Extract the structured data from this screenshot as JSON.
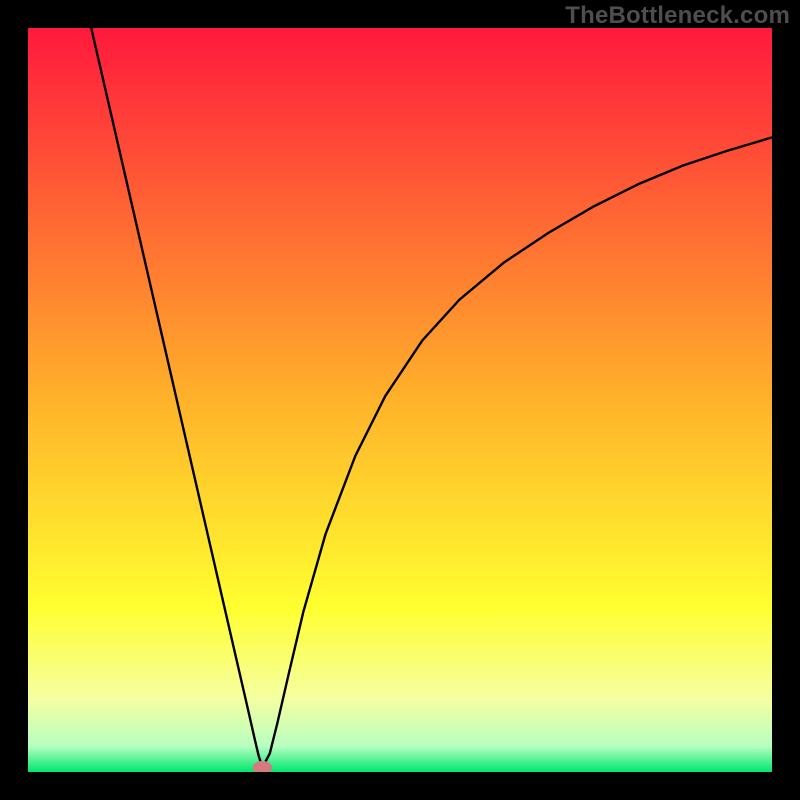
{
  "watermark": "TheBottleneck.com",
  "chart_data": {
    "type": "line",
    "title": "",
    "xlabel": "",
    "ylabel": "",
    "xlim": [
      0,
      100
    ],
    "ylim": [
      0,
      100
    ],
    "grid": false,
    "legend": false,
    "background_gradient_stops": [
      {
        "offset": 0.0,
        "color": "#ff193d"
      },
      {
        "offset": 0.5,
        "color": "#ffb22a"
      },
      {
        "offset": 0.78,
        "color": "#ffff30"
      },
      {
        "offset": 0.9,
        "color": "#f6ffa0"
      },
      {
        "offset": 0.965,
        "color": "#b8ffc0"
      },
      {
        "offset": 1.0,
        "color": "#00e66e"
      }
    ],
    "minimum_marker": {
      "x": 31.5,
      "y": 0.6,
      "rx": 1.3,
      "ry": 0.9,
      "color": "#d67a82"
    },
    "series": [
      {
        "name": "curve",
        "color": "#000000",
        "points": [
          {
            "x": 8.5,
            "y": 100.0
          },
          {
            "x": 10.0,
            "y": 93.5
          },
          {
            "x": 12.0,
            "y": 84.8
          },
          {
            "x": 14.0,
            "y": 76.1
          },
          {
            "x": 16.0,
            "y": 67.4
          },
          {
            "x": 18.0,
            "y": 58.7
          },
          {
            "x": 20.0,
            "y": 50.0
          },
          {
            "x": 22.0,
            "y": 41.3
          },
          {
            "x": 24.0,
            "y": 32.6
          },
          {
            "x": 26.0,
            "y": 23.9
          },
          {
            "x": 28.0,
            "y": 15.2
          },
          {
            "x": 29.5,
            "y": 8.7
          },
          {
            "x": 30.5,
            "y": 4.3
          },
          {
            "x": 31.0,
            "y": 2.2
          },
          {
            "x": 31.5,
            "y": 0.6
          },
          {
            "x": 32.5,
            "y": 2.5
          },
          {
            "x": 33.5,
            "y": 6.5
          },
          {
            "x": 35.0,
            "y": 13.0
          },
          {
            "x": 37.0,
            "y": 21.5
          },
          {
            "x": 40.0,
            "y": 32.0
          },
          {
            "x": 44.0,
            "y": 42.5
          },
          {
            "x": 48.0,
            "y": 50.5
          },
          {
            "x": 53.0,
            "y": 58.0
          },
          {
            "x": 58.0,
            "y": 63.5
          },
          {
            "x": 64.0,
            "y": 68.5
          },
          {
            "x": 70.0,
            "y": 72.5
          },
          {
            "x": 76.0,
            "y": 76.0
          },
          {
            "x": 82.0,
            "y": 79.0
          },
          {
            "x": 88.0,
            "y": 81.5
          },
          {
            "x": 94.0,
            "y": 83.5
          },
          {
            "x": 100.0,
            "y": 85.3
          }
        ]
      }
    ]
  }
}
